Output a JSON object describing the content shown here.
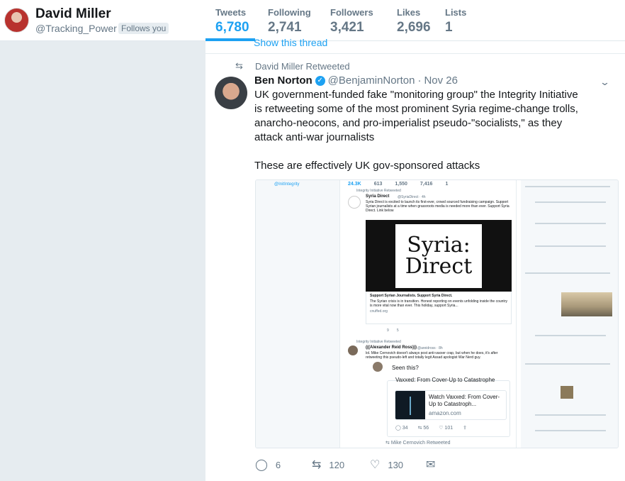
{
  "profile": {
    "name": "David Miller",
    "handle": "@Tracking_Power",
    "follows_badge": "Follows you"
  },
  "stats": [
    {
      "label": "Tweets",
      "value": "6,780",
      "active": true
    },
    {
      "label": "Following",
      "value": "2,741",
      "active": false
    },
    {
      "label": "Followers",
      "value": "3,421",
      "active": false
    },
    {
      "label": "Likes",
      "value": "2,696",
      "active": false
    },
    {
      "label": "Lists",
      "value": "1",
      "active": false
    }
  ],
  "timeline": {
    "show_thread": "Show this thread",
    "tweet": {
      "retweeted_by": "David Miller Retweeted",
      "author_name": "Ben Norton",
      "author_handle": "@BenjaminNorton",
      "date_sep": "·",
      "date": "Nov 26",
      "text_p1": "UK government-funded fake \"monitoring group\" the Integrity Initiative is retweeting some of the most prominent Syria regime-change trolls, anarcho-neocons, and pro-imperialist pseudo-\"socialists,\" as they attack anti-war journalists",
      "text_p2": "These are effectively UK gov-sponsored attacks",
      "replies": "6",
      "retweets": "120",
      "likes": "130"
    },
    "media": {
      "handle": "@InitIntegrity",
      "stats": [
        "24.3K",
        "613",
        "1,550",
        "7,416",
        "1"
      ],
      "rt1": "Integrity Initiative Retweeted",
      "tw1_name": "Syria Direct",
      "tw1_handle": "@SyriaDirect · 4h",
      "tw1_text": "Syria Direct is excited to launch its first-ever, crowd sourced fundraising campaign. Support Syrian journalists at a time when grassroots media is needed more than ever. Support Syria Direct. Link below",
      "banner_line1": "Syria:",
      "banner_line2": "Direct",
      "card_title": "Support Syrian Journalists. Support Syria Direct.",
      "card_desc": "The Syrian crisis is in transition. Honest reporting on events unfolding inside the country is more vital now than ever. This holiday, support Syria...",
      "card_url": "cnuffed.org",
      "tw1_actions": "9        5",
      "rt2": "Integrity Initiative Retweeted",
      "tw2_name": "(((Alexander Reid Ross)))",
      "tw2_handle": "@areidross · 8h",
      "tw2_text": "lol. Mike Cernovich doesn't always post anti-vaxxer crap, but when he does, it's after retweeting this pseudo-left and totally legit Assad apologist War Nerd guy.",
      "seen_this": "Seen this?",
      "vax_title": "Vaxxed: From Cover-Up to Catastrophe",
      "vax_box_text": "Watch Vaxxed: From Cover-Up to Catastroph...",
      "vax_domain": "amazon.com",
      "vax_replies": "34",
      "vax_retweets": "56",
      "vax_likes": "101",
      "vax_rt": "Mike Cernovich",
      "vax_rt_suffix": "Retweeted"
    }
  },
  "colors": {
    "accent": "#1da1f2",
    "muted": "#657786",
    "background": "#e6ecf0"
  },
  "icons": {
    "retweet": "retweet-icon",
    "reply": "reply-icon",
    "like": "heart-icon",
    "message": "envelope-icon",
    "verified": "verified-badge-icon",
    "menu": "chevron-down-icon"
  }
}
